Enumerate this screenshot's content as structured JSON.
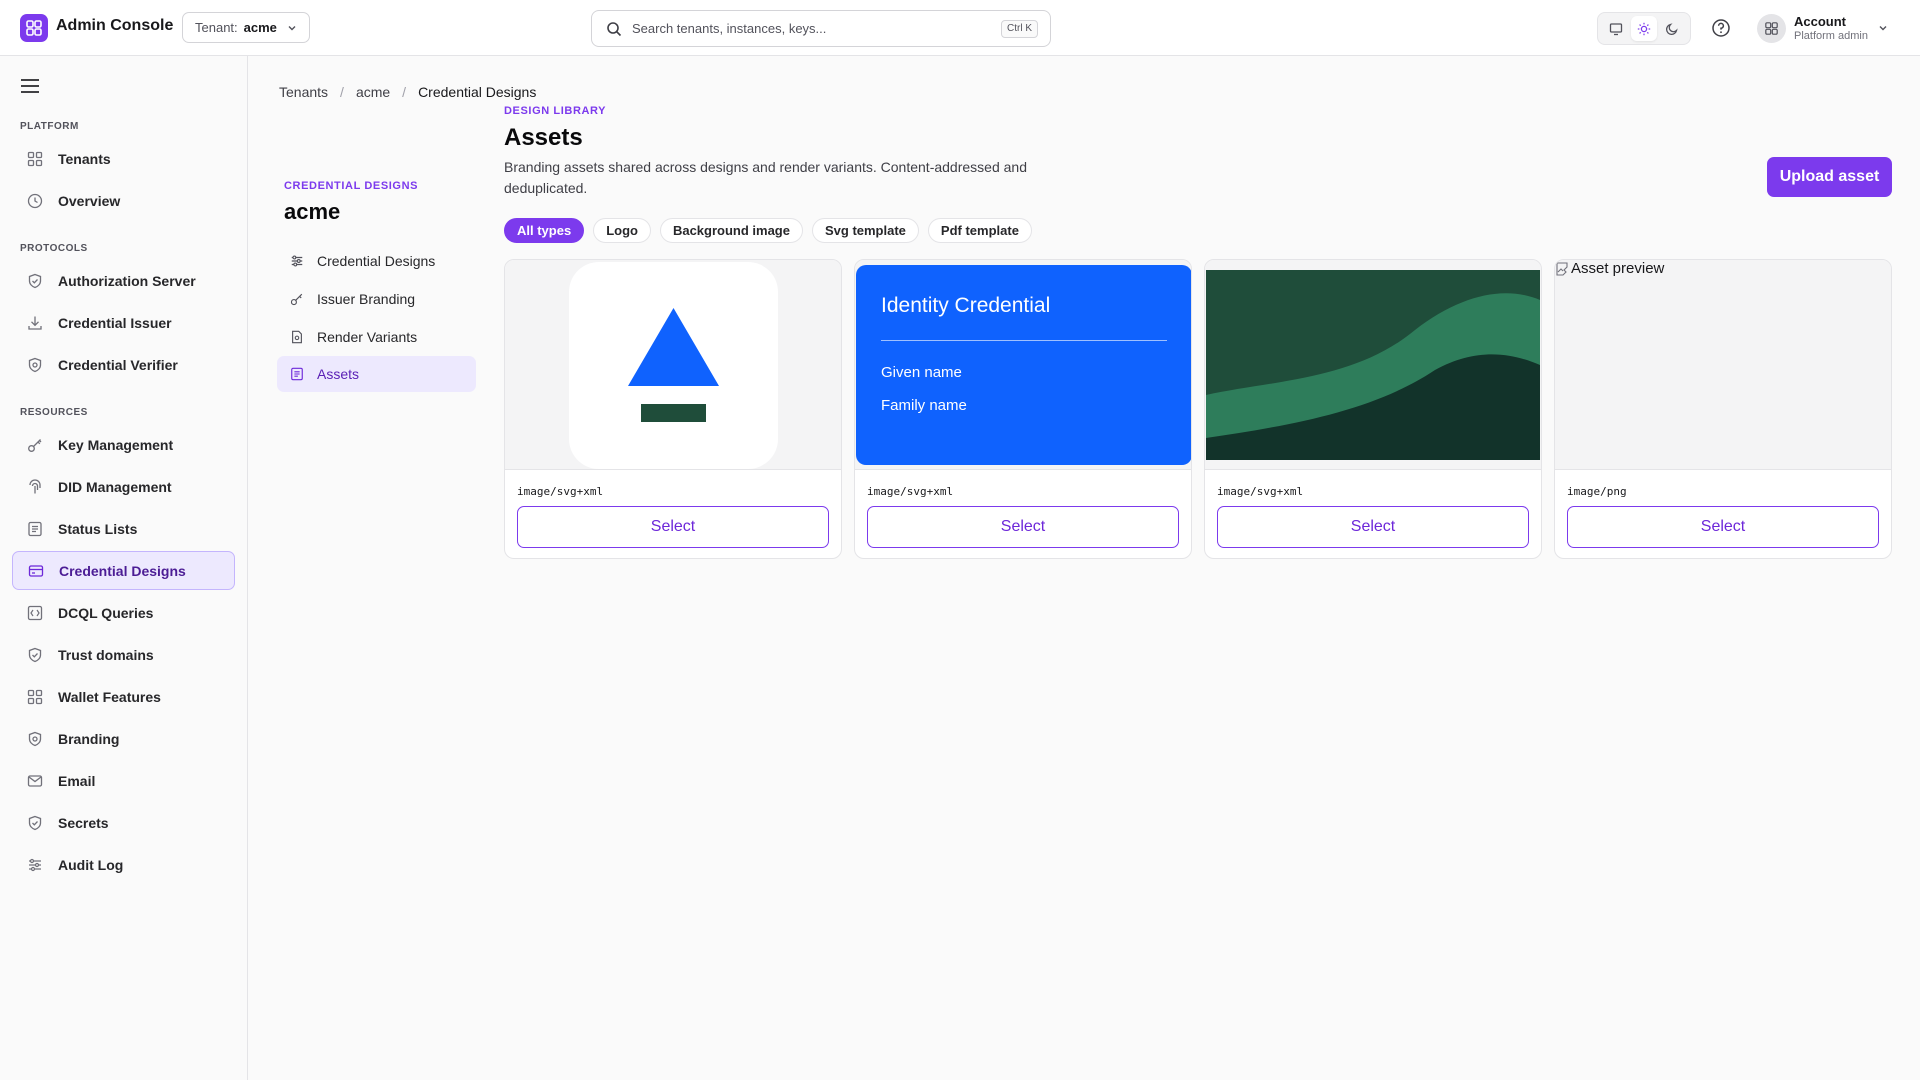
{
  "app": {
    "title": "Admin Console"
  },
  "tenant_select": {
    "label": "Tenant:",
    "value": "acme"
  },
  "search": {
    "placeholder": "Search tenants, instances, keys...",
    "shortcut": "Ctrl K"
  },
  "account": {
    "name": "Account",
    "role": "Platform admin"
  },
  "sidebar": {
    "sections": [
      {
        "label": "Platform",
        "items": [
          {
            "label": "Tenants",
            "icon": "grid-icon"
          },
          {
            "label": "Overview",
            "icon": "clock-icon"
          }
        ]
      },
      {
        "label": "Protocols",
        "items": [
          {
            "label": "Authorization Server",
            "icon": "shield-icon"
          },
          {
            "label": "Credential Issuer",
            "icon": "download-icon"
          },
          {
            "label": "Credential Verifier",
            "icon": "shield-check-icon"
          }
        ]
      },
      {
        "label": "Resources",
        "items": [
          {
            "label": "Key Management",
            "icon": "key-icon"
          },
          {
            "label": "DID Management",
            "icon": "fingerprint-icon"
          },
          {
            "label": "Status Lists",
            "icon": "list-icon"
          },
          {
            "label": "Credential Designs",
            "icon": "credit-card-icon",
            "active": true
          },
          {
            "label": "DCQL Queries",
            "icon": "query-icon"
          },
          {
            "label": "Trust domains",
            "icon": "shield-icon"
          },
          {
            "label": "Wallet Features",
            "icon": "grid-icon"
          },
          {
            "label": "Branding",
            "icon": "shield-icon"
          },
          {
            "label": "Email",
            "icon": "mail-icon"
          },
          {
            "label": "Secrets",
            "icon": "shield-icon"
          },
          {
            "label": "Audit Log",
            "icon": "sliders-icon"
          }
        ]
      }
    ]
  },
  "breadcrumb": [
    "Tenants",
    "acme",
    "Credential Designs"
  ],
  "subnav": {
    "eyebrow": "CREDENTIAL DESIGNS",
    "title": "acme",
    "items": [
      {
        "label": "Credential Designs",
        "icon": "sliders-icon"
      },
      {
        "label": "Issuer Branding",
        "icon": "key-icon"
      },
      {
        "label": "Render Variants",
        "icon": "file-icon"
      },
      {
        "label": "Assets",
        "icon": "list-icon",
        "active": true
      }
    ]
  },
  "main": {
    "eyebrow": "DESIGN LIBRARY",
    "title": "Assets",
    "description": "Branding assets shared across designs and render variants. Content-addressed and deduplicated.",
    "upload_label": "Upload asset",
    "filters": [
      "All types",
      "Logo",
      "Background image",
      "Svg template",
      "Pdf template"
    ],
    "active_filter": "All types",
    "assets": [
      {
        "mime": "image/svg+xml",
        "select_label": "Select",
        "preview": "logo"
      },
      {
        "mime": "image/svg+xml",
        "select_label": "Select",
        "preview": "credential-card",
        "card": {
          "title": "Identity Credential",
          "field1": "Given name",
          "field2": "Family name"
        }
      },
      {
        "mime": "image/svg+xml",
        "select_label": "Select",
        "preview": "background-waves"
      },
      {
        "mime": "image/png",
        "select_label": "Select",
        "preview": "broken-image",
        "alt": "Asset preview"
      }
    ]
  },
  "colors": {
    "accent": "#7c3aed",
    "card_blue": "#0f62fe",
    "dark_green": "#1f4d3a",
    "mid_green": "#2e7d5b"
  }
}
